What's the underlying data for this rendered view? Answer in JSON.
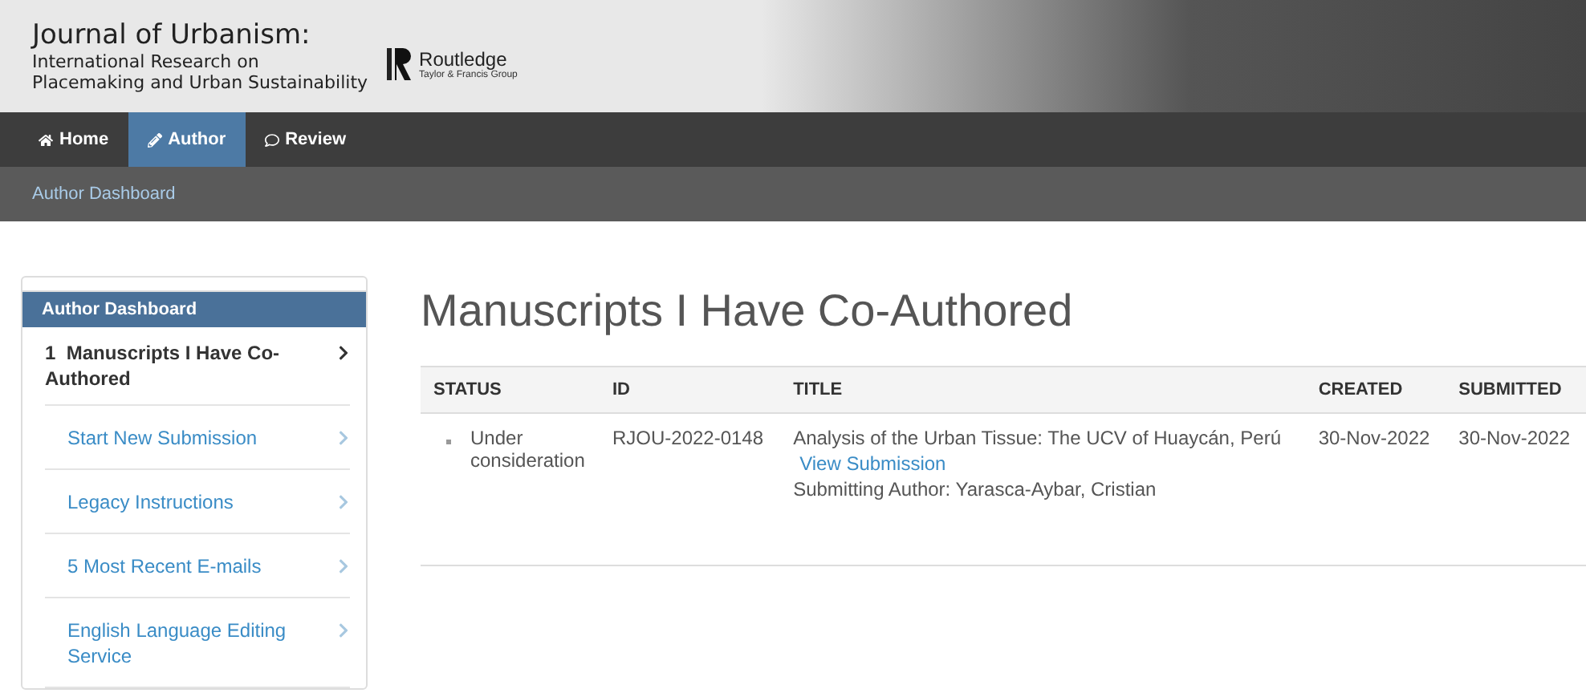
{
  "header": {
    "journal_title": "Journal of Urbanism:",
    "journal_subtitle_1": "International Research on",
    "journal_subtitle_2": "Placemaking and Urban Sustainability",
    "publisher": "Routledge",
    "publisher_group": "Taylor & Francis Group"
  },
  "nav": [
    {
      "label": "Home",
      "selected": false
    },
    {
      "label": "Author",
      "selected": true
    },
    {
      "label": "Review",
      "selected": false
    }
  ],
  "breadcrumb": "Author Dashboard",
  "sidebar": {
    "title": "Author Dashboard",
    "items": [
      {
        "count": "1",
        "label": "Manuscripts I Have Co-Authored",
        "selected": true
      },
      {
        "label": "Start New Submission",
        "selected": false
      },
      {
        "label": "Legacy Instructions",
        "selected": false
      },
      {
        "label": "5 Most Recent E-mails",
        "selected": false
      },
      {
        "label": "English Language Editing Service",
        "selected": false
      }
    ]
  },
  "page_title": "Manuscripts I Have Co-Authored",
  "table": {
    "columns": [
      "STATUS",
      "ID",
      "TITLE",
      "CREATED",
      "SUBMITTED"
    ],
    "rows": [
      {
        "status": "Under consideration",
        "id": "RJOU-2022-0148",
        "title": "Analysis of the Urban Tissue: The UCV of Huaycán, Perú",
        "link": "View Submission",
        "author": "Submitting Author: Yarasca-Aybar, Cristian",
        "created": "30-Nov-2022",
        "submitted": "30-Nov-2022"
      }
    ]
  }
}
